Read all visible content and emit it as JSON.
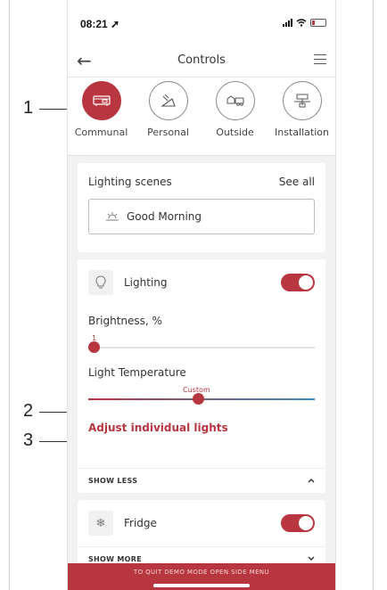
{
  "callouts": [
    "1",
    "2",
    "3"
  ],
  "status": {
    "time": "08:21"
  },
  "nav": {
    "back": "←",
    "title": "Controls"
  },
  "tabs": [
    {
      "label": "Communal",
      "icon": "communal-icon",
      "active": true
    },
    {
      "label": "Personal",
      "icon": "personal-icon",
      "active": false
    },
    {
      "label": "Outside",
      "icon": "outside-icon",
      "active": false
    },
    {
      "label": "Installation",
      "icon": "installation-icon",
      "active": false
    }
  ],
  "scenes": {
    "title": "Lighting scenes",
    "see_all": "See all",
    "current": "Good Morning",
    "icon": "sunrise-icon"
  },
  "lighting": {
    "title": "Lighting",
    "enabled": true,
    "brightness_label": "Brightness, %",
    "brightness_value": "1",
    "temperature_label": "Light Temperature",
    "temperature_value": "Custom",
    "adjust_link": "Adjust individual lights",
    "show_less": "SHOW LESS"
  },
  "fridge": {
    "title": "Fridge",
    "enabled": true,
    "show_more": "SHOW MORE"
  },
  "banner": "TO QUIT DEMO MODE OPEN SIDE MENU",
  "colors": {
    "accent": "#b8363f",
    "cool": "#3a88c7"
  }
}
